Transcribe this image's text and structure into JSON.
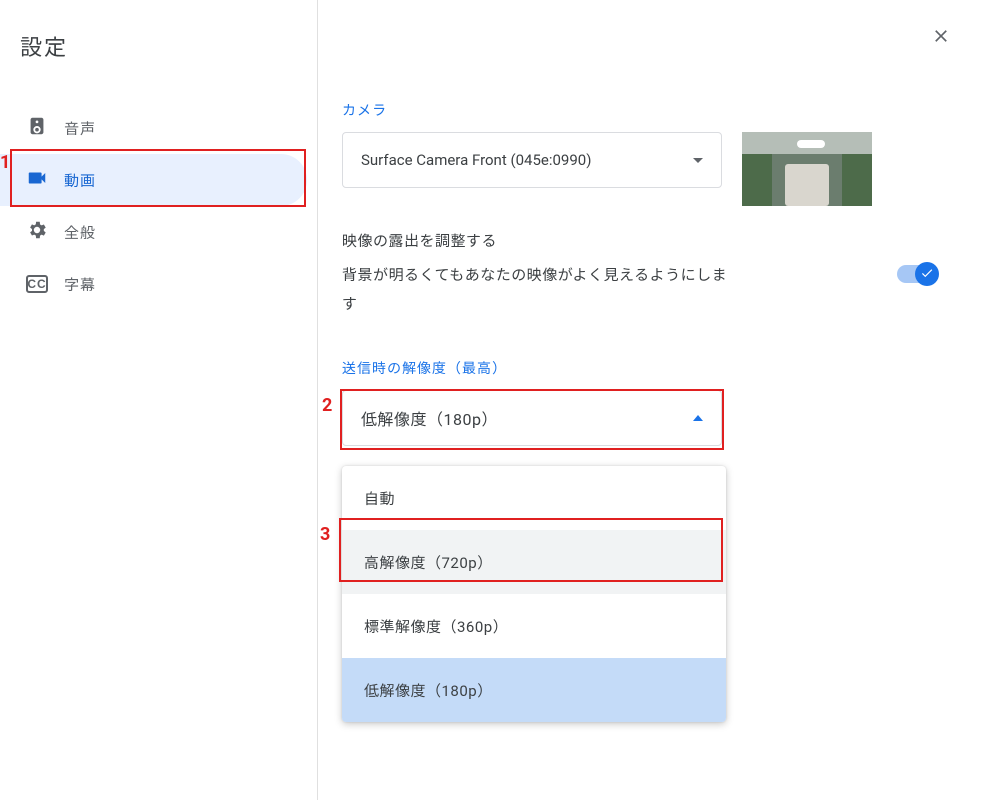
{
  "title": "設定",
  "sidebar": {
    "items": [
      {
        "label": "音声",
        "icon": "speaker-icon"
      },
      {
        "label": "動画",
        "icon": "camera-icon"
      },
      {
        "label": "全般",
        "icon": "gear-icon"
      },
      {
        "label": "字幕",
        "icon": "cc-icon"
      }
    ],
    "active_index": 1
  },
  "camera": {
    "label": "カメラ",
    "selected": "Surface Camera Front (045e:0990)"
  },
  "exposure": {
    "title": "映像の露出を調整する",
    "description": "背景が明るくてもあなたの映像がよく見えるようにします",
    "enabled": true
  },
  "resolution": {
    "label": "送信時の解像度（最高）",
    "selected": "低解像度（180p）",
    "options": [
      {
        "label": "自動",
        "state": ""
      },
      {
        "label": "高解像度（720p）",
        "state": "hover"
      },
      {
        "label": "標準解像度（360p）",
        "state": ""
      },
      {
        "label": "低解像度（180p）",
        "state": "selected"
      }
    ]
  },
  "annotations": {
    "a1": "1",
    "a2": "2",
    "a3": "3"
  }
}
